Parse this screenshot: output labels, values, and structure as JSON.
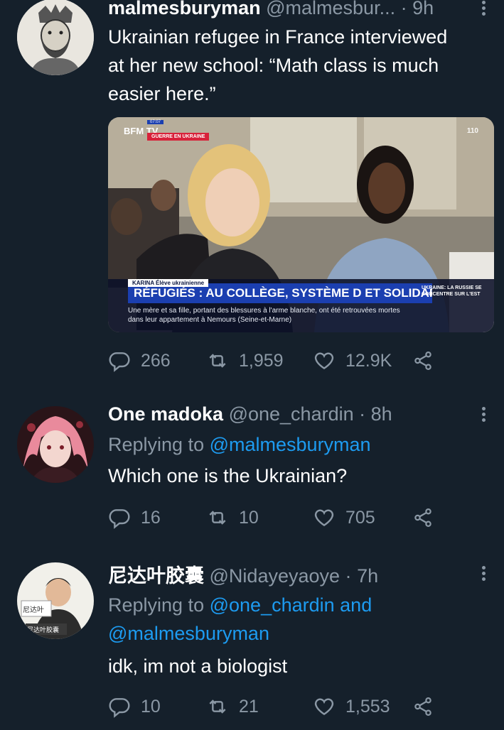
{
  "tweets": [
    {
      "display_name": "malmesburyman",
      "handle": "@malmesbur...",
      "dot": "·",
      "time": "9h",
      "text_lines": [
        "Ukrainian refugee in France interviewed",
        "at her new school: “Math class is much",
        "easier here.”"
      ],
      "actions": {
        "replies": "266",
        "retweets": "1,959",
        "likes": "12.9K"
      }
    },
    {
      "display_name": "One madoka",
      "handle": "@one_chardin",
      "dot": "·",
      "time": "8h",
      "replying_prefix": "Replying to",
      "replying_to": "@malmesburyman",
      "text": "Which one is the Ukrainian?",
      "actions": {
        "replies": "16",
        "retweets": "10",
        "likes": "705"
      }
    },
    {
      "display_name": "尼达叶胶囊",
      "handle": "@Nidayeyaoye",
      "dot": "·",
      "time": "7h",
      "replying_prefix": "Replying to",
      "replying_to_1": "@one_chardin",
      "replying_and": "and",
      "replying_to_2": "@malmesburyman",
      "text": "idk, im not a biologist",
      "actions": {
        "replies": "10",
        "retweets": "21",
        "likes": "1,553"
      },
      "avatar_labels": {
        "sign_top": "尼达叶",
        "sign_bottom": "尼达叶胶囊"
      }
    }
  ],
  "media": {
    "channel_logo": "BFM TV.",
    "date_tag": "07:07",
    "section_tag": "GUERRE EN UKRAINE",
    "corner": "110",
    "name_tag": "KARINA  Élève ukrainienne",
    "headline": "RÉFUGIÉS : AU COLLÈGE, SYSTÈME D ET SOLIDARITÉ",
    "subtitle": "Une mère et sa fille, portant des blessures à l'arme blanche, ont été retrouvées mortes dans leur appartement à Nemours (Seine-et-Marne)",
    "side_text": "UKRAINE: LA RUSSIE SE CONCENTRE SUR L'EST"
  },
  "colors": {
    "background": "#15202b",
    "muted": "#8b98a5",
    "link": "#1d9bf0",
    "banner_blue": "#1b3fb0"
  }
}
